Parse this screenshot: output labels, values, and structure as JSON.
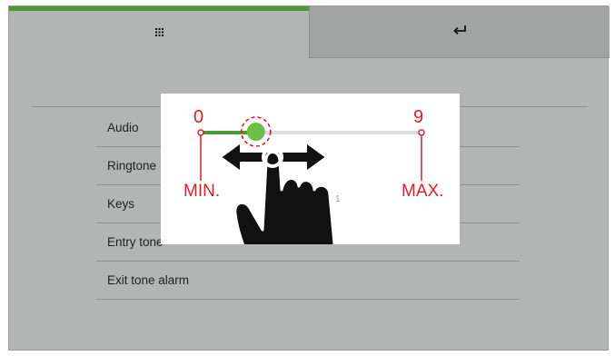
{
  "tabs": {
    "left": {
      "icon": "grid-icon"
    },
    "right": {
      "icon": "return-arrow-icon"
    }
  },
  "menu": {
    "items": [
      {
        "label": "Audio"
      },
      {
        "label": "Ringtone"
      },
      {
        "label": "Keys"
      },
      {
        "label": "Entry tone"
      },
      {
        "label": "Exit tone alarm"
      }
    ]
  },
  "overlay": {
    "slider": {
      "min_value": "0",
      "max_value": "9",
      "current_fraction": 0.25
    },
    "min_label": "MIN.",
    "max_label": "MAX.",
    "gesture_icon": "hand-swipe-icon",
    "partial_text": "1"
  },
  "colors": {
    "accent_green": "#4a9a33",
    "annotation_red": "#d8202a",
    "panel_gray": "#b3b5b4"
  }
}
